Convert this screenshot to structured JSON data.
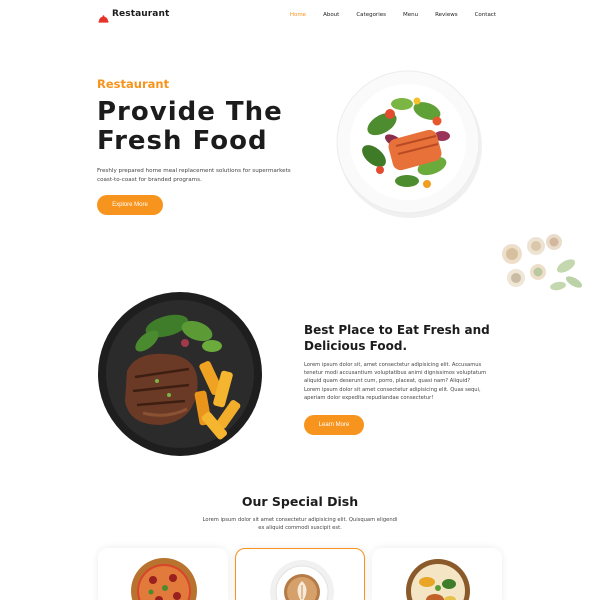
{
  "brand": {
    "name": "Restaurant",
    "accent": "#f7941d"
  },
  "nav": {
    "items": [
      {
        "label": "Home",
        "active": true
      },
      {
        "label": "About",
        "active": false
      },
      {
        "label": "Categories",
        "active": false
      },
      {
        "label": "Menu",
        "active": false
      },
      {
        "label": "Reviews",
        "active": false
      },
      {
        "label": "Contact",
        "active": false
      }
    ]
  },
  "hero": {
    "kicker": "Restaurant",
    "title_line1": "Provide The",
    "title_line2": "Fresh Food",
    "description": "Freshly prepared home meal replacement solutions for supermarkets coast-to-coast for branded programs.",
    "cta": "Explore More",
    "image": "salmon-salad-plate"
  },
  "about": {
    "title": "Best Place to Eat Fresh and Delicious Food.",
    "paragraph1": "Lorem ipsum dolor sit, amet consectetur adipisicing elit. Accusamus tenetur modi accusantium voluptatibus animi dignissimos voluptatum aliquid quam deserunt cum, porro, placeat, quasi nam? Aliquid?",
    "paragraph2": "Lorem ipsum dolor sit amet consectetur adipisicing elit. Quas sequi, aperiam dolor expedita repudiandae consectetur!",
    "cta": "Learn More",
    "image": "steak-fries-plate"
  },
  "special": {
    "title": "Our Special Dish",
    "description": "Lorem ipsum dolor sit amet consectetur adipisicing elit. Quisquam eligendi ex aliquid commodi suscipit est.",
    "cards": [
      {
        "image": "pizza"
      },
      {
        "image": "coffee-cup"
      },
      {
        "image": "rice-bowl"
      }
    ]
  }
}
